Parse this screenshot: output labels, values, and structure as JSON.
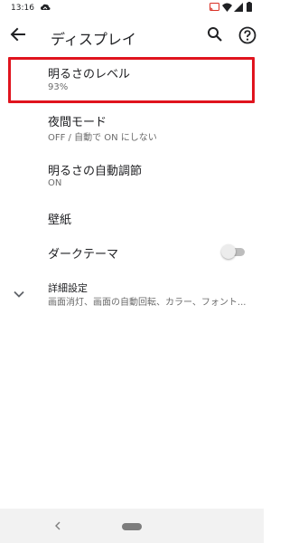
{
  "status_bar": {
    "time": "13:16",
    "icons": [
      "cloud-icon",
      "cast-icon",
      "wifi-icon",
      "signal-icon",
      "battery-icon"
    ]
  },
  "app_bar": {
    "title": "ディスプレイ",
    "icons": [
      "back-arrow-icon",
      "search-icon",
      "help-icon"
    ]
  },
  "settings": {
    "brightness": {
      "title": "明るさのレベル",
      "value": "93%"
    },
    "night_mode": {
      "title": "夜間モード",
      "summary": "OFF / 自動で ON にしない"
    },
    "auto_brightness": {
      "title": "明るさの自動調節",
      "summary": "ON"
    },
    "wallpaper": {
      "title": "壁紙"
    },
    "dark_theme": {
      "title": "ダークテーマ",
      "enabled": false
    },
    "advanced": {
      "title": "詳細設定",
      "summary": "画面消灯、画面の自動回転、カラー、フォント..."
    }
  },
  "colors": {
    "highlight_border": "#e0141e",
    "toggle_track_off": "#bdbdbd",
    "toggle_thumb_off": "#ececec",
    "navbar_bg": "#f2f2f2"
  }
}
